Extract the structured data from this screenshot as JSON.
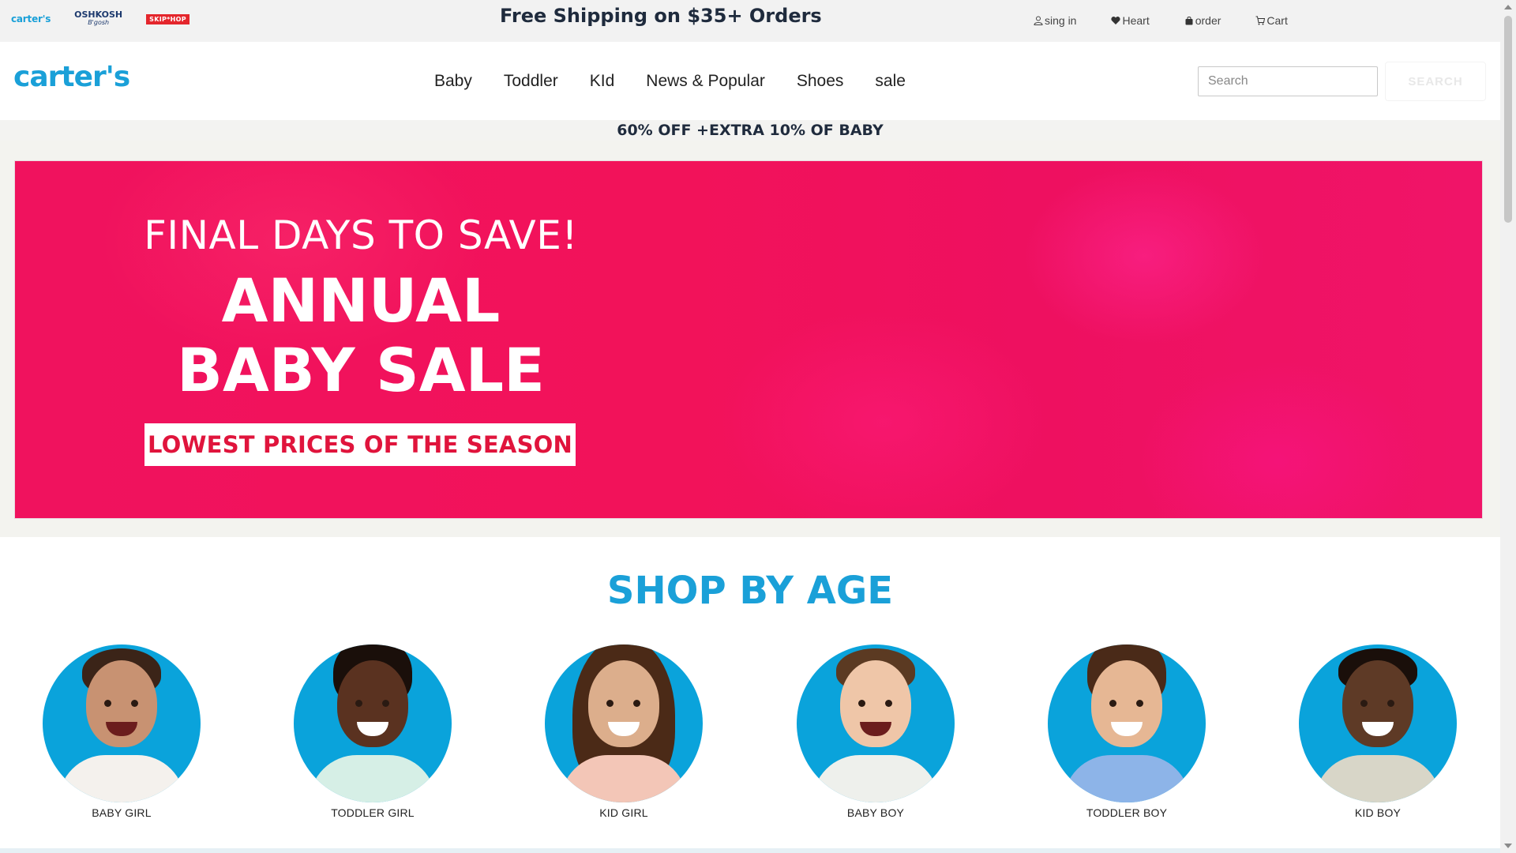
{
  "utility_bar": {
    "brands": [
      "carter's",
      "OSHKOSH",
      "B'gosh",
      "SKIP*HOP"
    ],
    "promo": "Free Shipping on $35+ Orders",
    "links": [
      {
        "label": "sing in",
        "icon": "user-icon"
      },
      {
        "label": "Heart",
        "icon": "heart-icon"
      },
      {
        "label": "order",
        "icon": "bag-icon"
      },
      {
        "label": "Cart",
        "icon": "cart-icon"
      }
    ]
  },
  "header": {
    "logo": "carter's",
    "nav": [
      "Baby",
      "Toddler",
      "KId",
      "News & Popular",
      "Shoes",
      "sale"
    ],
    "search_placeholder": "Search",
    "search_button": "SEARCH"
  },
  "sale_strip": "60% OFF +EXTRA 10% OF BABY",
  "hero": {
    "line1": "FINAL DAYS TO SAVE!",
    "line2": "ANNUAL",
    "line3": "BABY SALE",
    "cta": "LOWEST PRICES OF THE SEASON",
    "bg_color": "#f0125e"
  },
  "shop_by_age": {
    "title": "SHOP BY AGE",
    "items": [
      {
        "label": "BABY GIRL"
      },
      {
        "label": "TODDLER GIRL"
      },
      {
        "label": "KID GIRL"
      },
      {
        "label": "BABY BOY"
      },
      {
        "label": "TODDLER BOY"
      },
      {
        "label": "KID BOY"
      }
    ]
  },
  "colors": {
    "brand_blue": "#1aa0d8",
    "avatar_blue": "#0aa3db",
    "hero_pink": "#f0125e",
    "cta_red": "#e0143c"
  }
}
